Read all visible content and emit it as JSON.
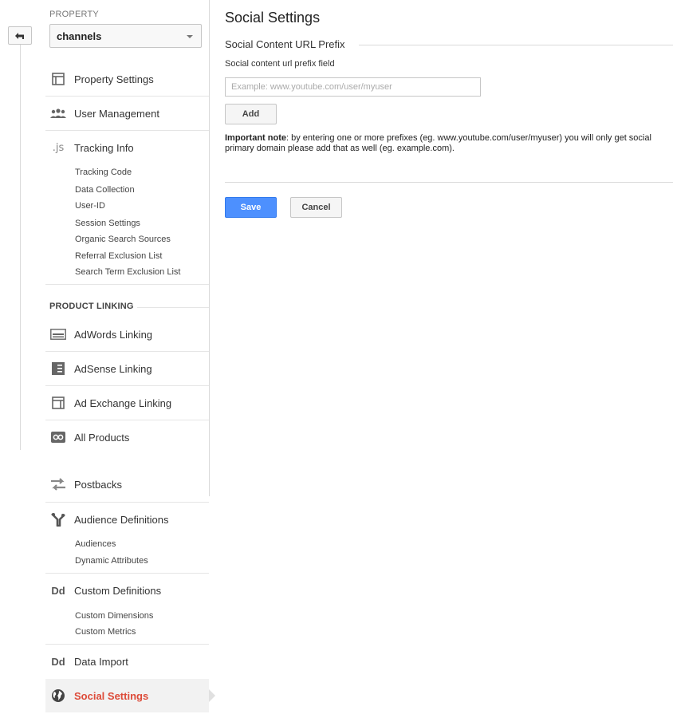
{
  "colors": {
    "primary": "#4d90fe",
    "active_nav": "#dd4b39"
  },
  "property": {
    "label": "PROPERTY",
    "selected": "channels"
  },
  "nav": {
    "property_settings": "Property Settings",
    "user_management": "User Management",
    "tracking_info": "Tracking Info",
    "tracking_sub": [
      "Tracking Code",
      "Data Collection",
      "User-ID",
      "Session Settings",
      "Organic Search Sources",
      "Referral Exclusion List",
      "Search Term Exclusion List"
    ],
    "product_linking_header": "PRODUCT LINKING",
    "adwords": "AdWords Linking",
    "adsense": "AdSense Linking",
    "adexchange": "Ad Exchange Linking",
    "all_products": "All Products",
    "postbacks": "Postbacks",
    "audience_definitions": "Audience Definitions",
    "audience_sub": [
      "Audiences",
      "Dynamic Attributes"
    ],
    "custom_definitions": "Custom Definitions",
    "custom_sub": [
      "Custom Dimensions",
      "Custom Metrics"
    ],
    "data_import": "Data Import",
    "social_settings": "Social Settings",
    "js_glyph": ".js",
    "dd_glyph": "Dd"
  },
  "main": {
    "title": "Social Settings",
    "section_title": "Social Content URL Prefix",
    "field_label": "Social content url prefix field",
    "input_placeholder": "Example: www.youtube.com/user/myuser",
    "input_value": "",
    "add_label": "Add",
    "note_bold": "Important note",
    "note_line1": ": by entering one or more prefixes (eg. www.youtube.com/user/myuser) you will only get social",
    "note_line2": "primary domain please add that as well (eg. example.com).",
    "save_label": "Save",
    "cancel_label": "Cancel"
  }
}
